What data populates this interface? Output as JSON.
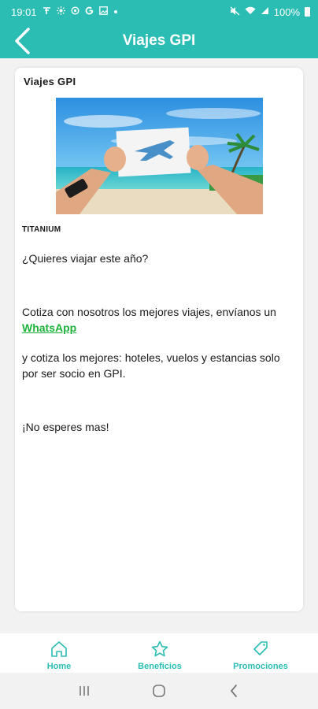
{
  "status": {
    "time": "19:01",
    "battery": "100%"
  },
  "appbar": {
    "title": "Viajes GPI"
  },
  "card": {
    "title": "Viajes GPI",
    "tier": "TITANIUM",
    "paragraph1": "¿Quieres viajar este año?",
    "paragraph2_text": "Cotiza con nosotros los mejores viajes, envíanos un ",
    "paragraph2_link": "WhatsApp",
    "paragraph3": "y cotiza los mejores: hoteles, vuelos y estancias solo por ser socio en GPI.",
    "paragraph4": "¡No esperes mas!"
  },
  "bottomnav": {
    "items": [
      {
        "label": "Home",
        "icon": "home-icon"
      },
      {
        "label": "Beneficios",
        "icon": "star-icon"
      },
      {
        "label": "Promociones",
        "icon": "tag-icon"
      }
    ]
  },
  "colors": {
    "primary": "#2bbdb4",
    "link": "#1db23a"
  }
}
